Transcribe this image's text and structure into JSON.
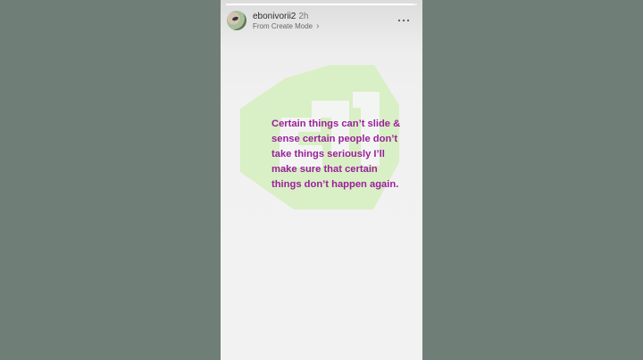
{
  "story": {
    "progress_fraction": 0.98,
    "header": {
      "username": "ebonivorii2",
      "time": "2h",
      "mode_label": "From Create Mode",
      "more_icon": "more-horizontal-icon",
      "chevron_icon": "chevron-right-icon"
    },
    "content": {
      "caption": "Certain things can’t slide & sense certain people don’t take things seriously I’ll make sure that certain things don’t happen again.",
      "caption_color": "#9a1f9b",
      "emblem_color": "#d9efc5"
    }
  }
}
